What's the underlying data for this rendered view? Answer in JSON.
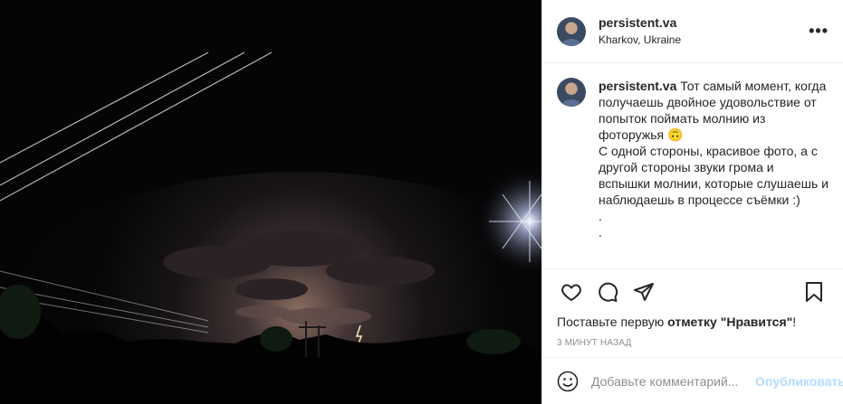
{
  "post": {
    "username": "persistent.va",
    "location": "Kharkov, Ukraine",
    "more_label": "•••",
    "caption_user": "persistent.va",
    "caption_text": " Тот самый момент, когда получаешь двойное удовольствие от попыток поймать молнию из фоторужья 🙃\nС одной стороны, красивое фото, а с другой стороны звуки грома и вспышки молнии, которые слушаешь и наблюдаешь в процессе съёмки :)\n.\n.",
    "likes_prefix": "Поставьте первую ",
    "likes_bold": "отметку \"Нравится\"",
    "likes_suffix": "!",
    "timestamp": "3 МИНУТ НАЗАД"
  },
  "icons": {
    "like": "heart-icon",
    "comment": "comment-icon",
    "share": "paper-plane-icon",
    "save": "bookmark-icon",
    "emoji": "smiley-icon"
  },
  "comment_box": {
    "placeholder": "Добавьте комментарий...",
    "post_label": "Опубликовать"
  },
  "colors": {
    "text": "#262626",
    "muted": "#8e8e8e",
    "post_disabled": "#b3dbff",
    "divider": "#efefef"
  }
}
